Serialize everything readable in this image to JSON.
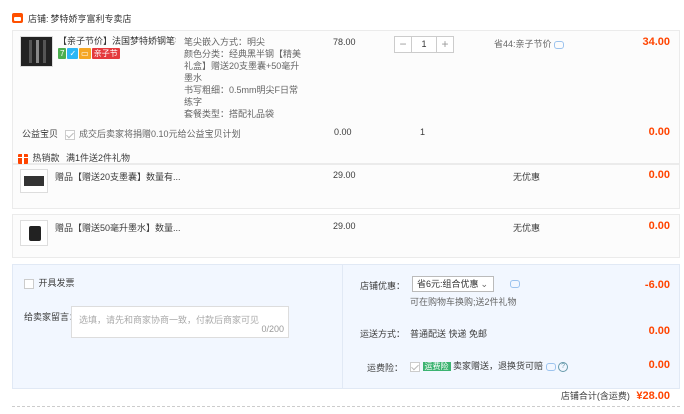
{
  "store": {
    "label": "店铺:",
    "name": "梦特娇亨富利专卖店"
  },
  "item": {
    "title": "【亲子节价】法国梦特娇钢笔学...",
    "badge": "亲子节",
    "specs": [
      "笔尖嵌入方式：明尖",
      "颜色分类：经典黑半钢【精美礼盒】赠送20支墨囊+50毫升墨水",
      "书写粗细：0.5mm明尖F日常练字",
      "套餐类型：搭配礼品袋"
    ],
    "unit_price": "78.00",
    "quantity": "1",
    "minus": "−",
    "plus": "+",
    "discount": "省44:亲子节价",
    "subtotal": "34.00"
  },
  "charity": {
    "label": "公益宝贝",
    "text": "成交后卖家将捐赠0.10元给公益宝贝计划",
    "price": "0.00",
    "qty": "1",
    "subtotal": "0.00"
  },
  "gift_promo": {
    "label": "热销款",
    "text": "满1件送2件礼物"
  },
  "gifts": [
    {
      "title": "赠品【赠送20支墨囊】数量有...",
      "price": "29.00",
      "promo": "无优惠",
      "subtotal": "0.00"
    },
    {
      "title": "赠品【赠送50毫升墨水】数量...",
      "price": "29.00",
      "promo": "无优惠",
      "subtotal": "0.00"
    }
  ],
  "invoice": {
    "label": "开具发票"
  },
  "message": {
    "label": "给卖家留言：",
    "placeholder": "选填，请先和商家协商一致，付款后商家可见",
    "counter": "0/200"
  },
  "store_discount": {
    "label": "店铺优惠：",
    "selected": "省6元:组合优惠",
    "note": "可在购物车换购;送2件礼物",
    "amount": "-6.00"
  },
  "shipping": {
    "label": "运送方式：",
    "method": "普通配送 快递 免邮",
    "amount": "0.00"
  },
  "insurance": {
    "label": "运费险：",
    "badge": "运费险",
    "text": "卖家赠送，退换货可赔",
    "amount": "0.00"
  },
  "total": {
    "label": "店铺合计(含运费)",
    "amount": "¥28.00"
  },
  "colors": {
    "accent": "#ff4400",
    "panel": "#f2f7ff"
  }
}
